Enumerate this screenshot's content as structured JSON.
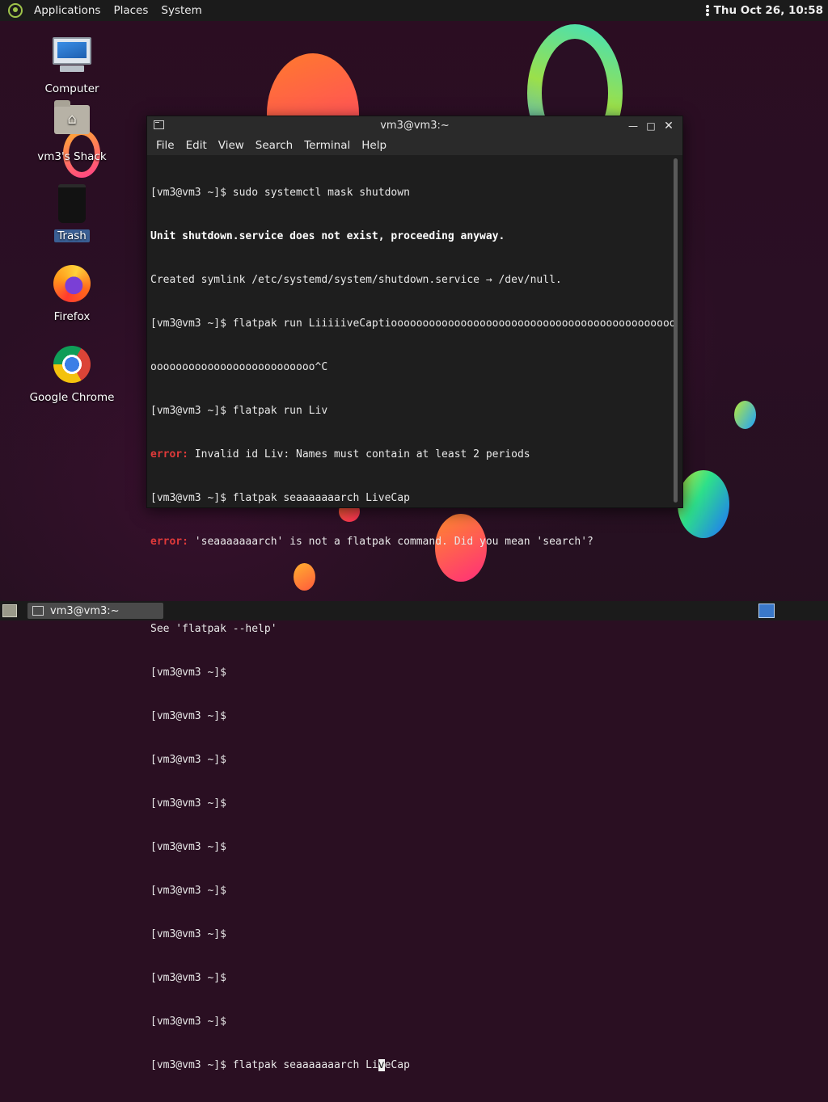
{
  "top_panel": {
    "menus": [
      "Applications",
      "Places",
      "System"
    ],
    "clock": "Thu Oct 26, 10:58"
  },
  "desktop_icons": [
    {
      "label": "Computer",
      "icon": "computer-icon"
    },
    {
      "label": "vm3's Shack",
      "icon": "home-folder-icon"
    },
    {
      "label": "Trash",
      "icon": "trash-icon"
    },
    {
      "label": "Firefox",
      "icon": "firefox-icon"
    },
    {
      "label": "Google Chrome",
      "icon": "chrome-icon"
    }
  ],
  "terminal": {
    "title": "vm3@vm3:~",
    "menus": [
      "File",
      "Edit",
      "View",
      "Search",
      "Terminal",
      "Help"
    ],
    "lines": [
      {
        "prefix": "",
        "text": "[vm3@vm3 ~]$ sudo systemctl mask shutdown"
      },
      {
        "prefix": "",
        "text": "Unit shutdown.service does not exist, proceeding anyway."
      },
      {
        "prefix": "",
        "text": "Created symlink /etc/systemd/system/shutdown.service → /dev/null."
      },
      {
        "prefix": "",
        "text": "[vm3@vm3 ~]$ flatpak run LiiiiiveCaptiooooooooooooooooooooooooooooooooooooooooooooo"
      },
      {
        "prefix": "",
        "text": "oooooooooooooooooooooooooo^C"
      },
      {
        "prefix": "",
        "text": "[vm3@vm3 ~]$ flatpak run Liv"
      },
      {
        "prefix": "error:",
        "text": " Invalid id Liv: Names must contain at least 2 periods"
      },
      {
        "prefix": "",
        "text": "[vm3@vm3 ~]$ flatpak seaaaaaaarch LiveCap"
      },
      {
        "prefix": "error:",
        "text": " 'seaaaaaaarch' is not a flatpak command. Did you mean 'search'?"
      },
      {
        "prefix": "",
        "text": ""
      },
      {
        "prefix": "",
        "text": "See 'flatpak --help'"
      },
      {
        "prefix": "",
        "text": "[vm3@vm3 ~]$"
      },
      {
        "prefix": "",
        "text": "[vm3@vm3 ~]$"
      },
      {
        "prefix": "",
        "text": "[vm3@vm3 ~]$"
      },
      {
        "prefix": "",
        "text": "[vm3@vm3 ~]$"
      },
      {
        "prefix": "",
        "text": "[vm3@vm3 ~]$"
      },
      {
        "prefix": "",
        "text": "[vm3@vm3 ~]$"
      },
      {
        "prefix": "",
        "text": "[vm3@vm3 ~]$"
      },
      {
        "prefix": "",
        "text": "[vm3@vm3 ~]$"
      },
      {
        "prefix": "",
        "text": "[vm3@vm3 ~]$"
      }
    ],
    "current_input": {
      "before_cursor": "[vm3@vm3 ~]$ flatpak seaaaaaaarch Li",
      "cursor_char": "v",
      "after_cursor": "eCap"
    }
  },
  "taskbar": {
    "window_button": "vm3@vm3:~"
  }
}
